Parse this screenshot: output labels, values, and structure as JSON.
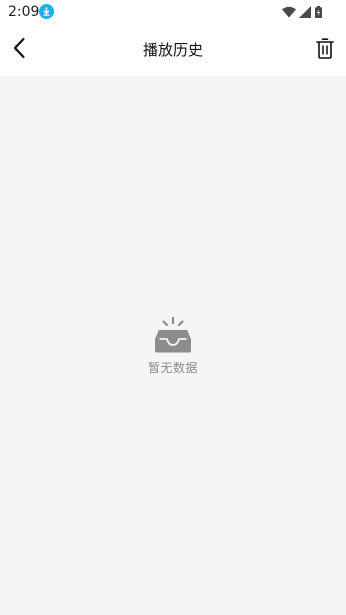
{
  "status_bar": {
    "time": "2:09",
    "icons": [
      "download-notification-icon",
      "wifi-icon",
      "cellular-signal-icon",
      "battery-charging-icon"
    ]
  },
  "header": {
    "title": "播放历史",
    "back_icon": "chevron-left-icon",
    "delete_icon": "trash-icon"
  },
  "empty_state": {
    "icon": "empty-inbox-icon",
    "message": "暂无数据"
  },
  "colors": {
    "background": "#f5f5f5",
    "header_background": "#ffffff",
    "download_badge": "#1ab0f0",
    "empty_icon": "#8c8c8c",
    "empty_text": "#8a8a8a"
  }
}
